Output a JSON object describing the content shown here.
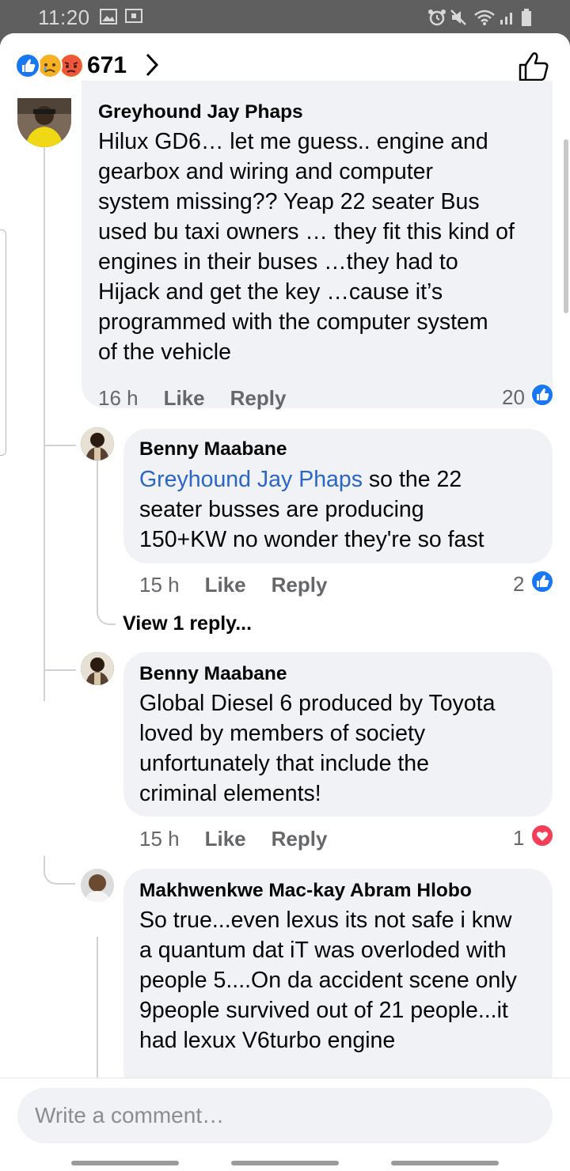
{
  "status_bar": {
    "time": "11:20"
  },
  "header": {
    "reaction_count": "671",
    "reaction_icons": [
      "like-icon",
      "sad-icon",
      "angry-icon"
    ]
  },
  "comments": [
    {
      "author": "Greyhound Jay Phaps",
      "text": "Hilux GD6… let me guess.. engine and\ngearbox and wiring and computer\nsystem missing?? Yeap 22 seater Bus\nused bu taxi owners … they fit this kind of\nengines in their buses …they had to\nHijack and get the key …cause it’s\nprogrammed with the computer system\nof the vehicle",
      "time": "16 h",
      "like_label": "Like",
      "reply_label": "Reply",
      "reaction_count": "20",
      "reaction_type": "like"
    },
    {
      "author": "Benny Maabane",
      "mention": "Greyhound Jay Phaps",
      "text": " so the 22\nseater busses are producing\n150+KW no wonder they're so fast",
      "time": "15 h",
      "like_label": "Like",
      "reply_label": "Reply",
      "reaction_count": "2",
      "reaction_type": "like"
    },
    {
      "author": "Benny Maabane",
      "text": "Global Diesel 6 produced by Toyota\nloved by members of society\nunfortunately that include the\ncriminal elements!",
      "time": "15 h",
      "like_label": "Like",
      "reply_label": "Reply",
      "reaction_count": "1",
      "reaction_type": "love"
    },
    {
      "author": "Makhwenkwe Mac-kay Abram Hlobo",
      "text": "So true...even lexus its not safe i knw\na quantum dat iT was overloded with\npeople 5....On da accident scene only\n9people survived out of 21 people...it\nhad lexux V6turbo engine"
    }
  ],
  "view_replies_label": "View 1 reply...",
  "composer": {
    "placeholder": "Write a comment…"
  },
  "colors": {
    "like_blue": "#1877f2",
    "love_red": "#f33e58",
    "mention_blue": "#2a66c6",
    "bubble_grey": "#f0f2f5"
  }
}
